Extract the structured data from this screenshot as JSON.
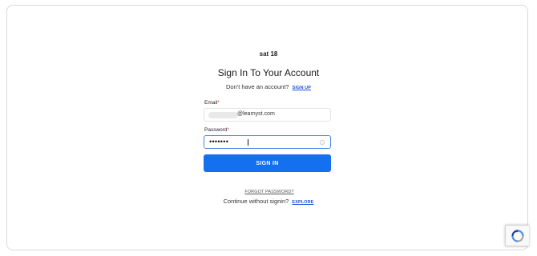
{
  "brand": {
    "name": "sat 18"
  },
  "title": "Sign In To Your Account",
  "signup": {
    "prompt": "Don't have an account?",
    "link": "SIGN UP"
  },
  "email": {
    "label": "Email",
    "required_mark": "*",
    "value": "@learnyst.com"
  },
  "password": {
    "label": "Password",
    "required_mark": "*",
    "value": "•••••••"
  },
  "sign_in_button": "SIGN IN",
  "forgot_password": "FORGOT PASSWORD?",
  "explore": {
    "prompt": "Continue without signin?",
    "link": "EXPLORE"
  },
  "colors": {
    "primary": "#1570f0",
    "link": "#1a4fd6",
    "focus_border": "#4a86e8"
  },
  "icons": {
    "password_toggle": "eye-icon",
    "captcha": "recaptcha-icon"
  }
}
